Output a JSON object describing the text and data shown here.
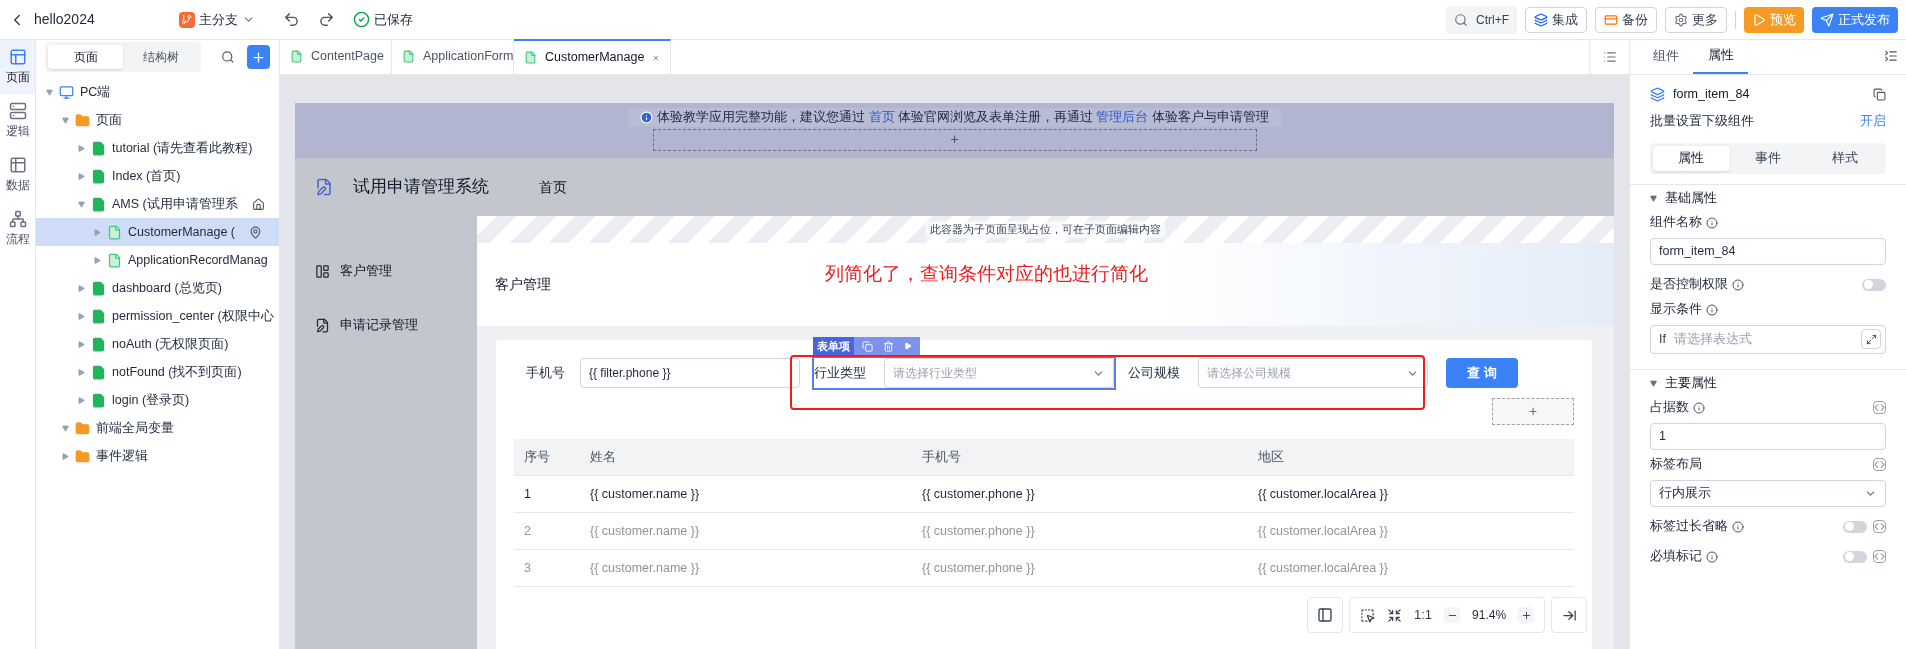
{
  "topbar": {
    "app_name": "hello2024",
    "branch": "主分支",
    "save_status": "已保存",
    "search_shortcut": "Ctrl+F",
    "buttons": [
      {
        "label": "集成",
        "kind": "integrate"
      },
      {
        "label": "备份",
        "kind": "backup"
      },
      {
        "label": "更多",
        "kind": "more"
      },
      {
        "label": "预览",
        "kind": "preview"
      },
      {
        "label": "正式发布",
        "kind": "publish"
      }
    ]
  },
  "rail": [
    {
      "label": "页面",
      "kind": "pages",
      "selected": true
    },
    {
      "label": "逻辑",
      "kind": "logic",
      "selected": false
    },
    {
      "label": "数据",
      "kind": "data",
      "selected": false
    },
    {
      "label": "流程",
      "kind": "flow",
      "selected": false
    }
  ],
  "tree_panel": {
    "tabs": [
      {
        "label": "页面",
        "selected": true
      },
      {
        "label": "结构树",
        "selected": false
      }
    ],
    "tree": [
      {
        "label": "PC端",
        "kind": "device",
        "expanded": true,
        "selected": false,
        "children": [
          {
            "label": "页面",
            "kind": "folder",
            "expanded": true,
            "selected": false,
            "children": [
              {
                "label": "tutorial (请先查看此教程)",
                "kind": "page",
                "expanded": false,
                "selected": false
              },
              {
                "label": "Index (首页)",
                "kind": "page",
                "expanded": false,
                "selected": false
              },
              {
                "label": "AMS (试用申请管理系",
                "kind": "page",
                "expanded": true,
                "selected": false,
                "is_home": true,
                "children": [
                  {
                    "label": "CustomerManage (",
                    "kind": "subpage",
                    "expanded": false,
                    "selected": true,
                    "pinned": true
                  },
                  {
                    "label": "ApplicationRecordManag",
                    "kind": "subpage",
                    "expanded": false,
                    "selected": false
                  }
                ]
              },
              {
                "label": "dashboard (总览页)",
                "kind": "page",
                "expanded": false,
                "selected": false
              },
              {
                "label": "permission_center (权限中心",
                "kind": "page",
                "expanded": false,
                "selected": false
              },
              {
                "label": "noAuth (无权限页面)",
                "kind": "page",
                "expanded": false,
                "selected": false
              },
              {
                "label": "notFound (找不到页面)",
                "kind": "page",
                "expanded": false,
                "selected": false
              },
              {
                "label": "login (登录页)",
                "kind": "page",
                "expanded": false,
                "selected": false
              }
            ]
          },
          {
            "label": "前端全局变量",
            "kind": "folder",
            "expanded": true,
            "selected": false
          },
          {
            "label": "事件逻辑",
            "kind": "folder",
            "expanded": false,
            "selected": false
          }
        ]
      }
    ]
  },
  "editor_tabs": [
    {
      "label": "ContentPage",
      "selected": false
    },
    {
      "label": "ApplicationForm",
      "selected": false
    },
    {
      "label": "CustomerManage",
      "selected": true
    }
  ],
  "canvas": {
    "banner": {
      "parts": [
        {
          "text": "体验教学应用完整功能，建议您通过 ",
          "kind": "text"
        },
        {
          "text": "首页",
          "kind": "link"
        },
        {
          "text": " 体验官网浏览及表单注册，再通过 ",
          "kind": "text"
        },
        {
          "text": "管理后台",
          "kind": "link"
        },
        {
          "text": " 体验客户与申请管理",
          "kind": "text"
        }
      ],
      "add_slot": "+"
    },
    "app_title": "试用申请管理系统",
    "nav": "首页",
    "side_nav": [
      {
        "label": "客户管理",
        "kind": "layout"
      },
      {
        "label": "申请记录管理",
        "kind": "edit"
      }
    ],
    "placeholder_note": "此容器为子页面呈现占位，可在子页面编辑内容",
    "page_title": "客户管理",
    "annotation": "列简化了，查询条件对应的也进行简化",
    "selection_tag": "表单项",
    "filters": [
      {
        "label": "手机号",
        "kind": "input",
        "value": "{{ filter.phone }}",
        "selected": false
      },
      {
        "label": "行业类型",
        "kind": "select",
        "placeholder": "请选择行业类型",
        "selected": true
      },
      {
        "label": "公司规模",
        "kind": "select",
        "placeholder": "请选择公司规模",
        "selected": false
      }
    ],
    "search_button": "查 询",
    "add_slot": "+",
    "table": {
      "columns": [
        "序号",
        "姓名",
        "手机号",
        "地区"
      ],
      "rows": [
        {
          "cells": [
            "1",
            "{{ customer.name }}",
            "{{ customer.phone }}",
            "{{ customer.localArea }}"
          ],
          "dimmed": false
        },
        {
          "cells": [
            "2",
            "{{ customer.name }}",
            "{{ customer.phone }}",
            "{{ customer.localArea }}"
          ],
          "dimmed": true
        },
        {
          "cells": [
            "3",
            "{{ customer.name }}",
            "{{ customer.phone }}",
            "{{ customer.localArea }}"
          ],
          "dimmed": true
        }
      ]
    },
    "zoom": {
      "ratio": "1:1",
      "value": "91.4%"
    }
  },
  "props_panel": {
    "tabs": [
      {
        "label": "组件",
        "selected": false
      },
      {
        "label": "属性",
        "selected": true
      }
    ],
    "component_name": "form_item_84",
    "batch_label": "批量设置下级组件",
    "batch_link": "开启",
    "sub_tabs": [
      {
        "label": "属性",
        "selected": true
      },
      {
        "label": "事件",
        "selected": false
      },
      {
        "label": "样式",
        "selected": false
      }
    ],
    "sections": [
      {
        "title": "基础属性",
        "expanded": true,
        "fields": [
          {
            "label": "组件名称",
            "kind": "input",
            "value": "form_item_84",
            "info": true,
            "code": false
          },
          {
            "label": "是否控制权限",
            "kind": "switch",
            "on": false,
            "info": true,
            "code": false
          },
          {
            "label": "显示条件",
            "kind": "expression",
            "prefix": "If",
            "placeholder": "请选择表达式",
            "info": true,
            "code": false
          }
        ]
      },
      {
        "title": "主要属性",
        "expanded": true,
        "fields": [
          {
            "label": "占据数",
            "kind": "input",
            "value": "1",
            "info": true,
            "code": true
          },
          {
            "label": "标签布局",
            "kind": "select",
            "value": "行内展示",
            "info": false,
            "code": true
          },
          {
            "label": "标签过长省略",
            "kind": "switch",
            "on": false,
            "info": true,
            "code": true
          },
          {
            "label": "必填标记",
            "kind": "switch",
            "on": false,
            "info": true,
            "code": true
          }
        ]
      }
    ]
  }
}
